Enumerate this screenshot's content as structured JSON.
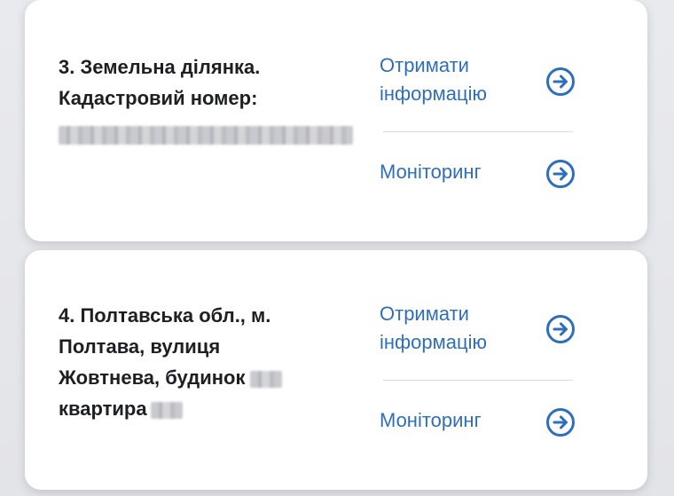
{
  "cards": [
    {
      "title_lines": [
        "3. Земельна ділянка.",
        "Кадастровий номер:"
      ],
      "actions": {
        "info_label": "Отримати інформацію",
        "monitoring_label": "Моніторинг"
      }
    },
    {
      "title_lines": [
        "4. Полтавська обл., м.",
        "Полтава, вулиця",
        "Жовтнева, будинок",
        "квартира"
      ],
      "actions": {
        "info_label": "Отримати інформацію",
        "monitoring_label": "Моніторинг"
      }
    }
  ],
  "icons": {
    "action_arrow": "arrow-right-circle-icon"
  },
  "colors": {
    "accent": "#2e6ebd",
    "text": "#1e1f23",
    "divider": "#d6dbe2",
    "background": "#e7e8ec",
    "card": "#ffffff"
  }
}
